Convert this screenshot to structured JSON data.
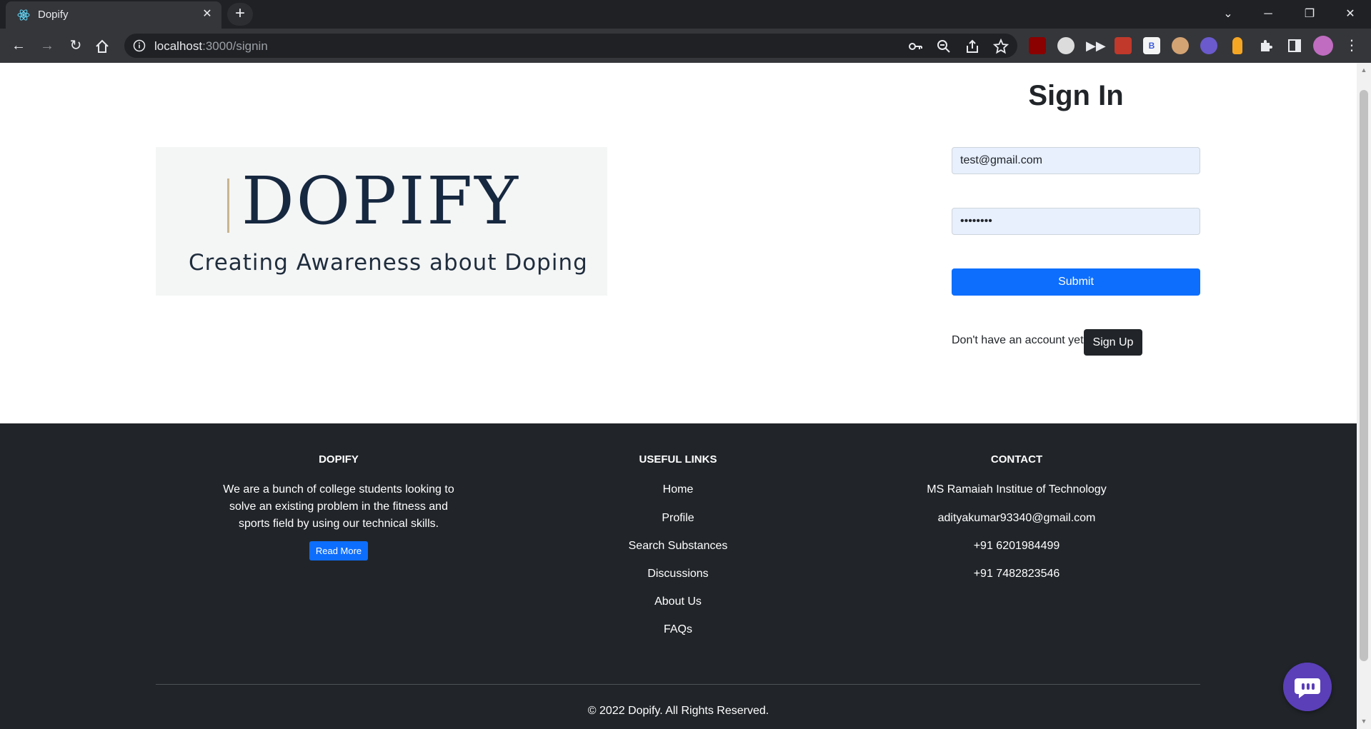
{
  "browser": {
    "tab_title": "Dopify",
    "url_host": "localhost",
    "url_path": ":3000/signin"
  },
  "signin": {
    "title": "Sign In",
    "email_value": "test@gmail.com",
    "password_value": "password",
    "submit_label": "Submit",
    "no_account_text": "Don't have an account yet",
    "signup_label": "Sign Up"
  },
  "logo": {
    "wordmark": "DOPIFY",
    "tagline": "Creating Awareness about Doping"
  },
  "footer": {
    "about": {
      "heading": "DOPIFY",
      "text": "We are a bunch of college students looking to solve an existing problem in the fitness and sports field by using our technical skills.",
      "read_more_label": "Read More"
    },
    "links": {
      "heading": "USEFUL LINKS",
      "items": [
        "Home",
        "Profile",
        "Search Substances",
        "Discussions",
        "About Us",
        "FAQs"
      ]
    },
    "contact": {
      "heading": "CONTACT",
      "items": [
        "MS Ramaiah Institue of Technology",
        "adityakumar93340@gmail.com",
        "+91 6201984499",
        "+91 7482823546"
      ]
    },
    "copyright": "© 2022 Dopify. All Rights Reserved."
  },
  "colors": {
    "primary": "#0d6efd",
    "dark": "#212529",
    "chat": "#5a3fb8"
  }
}
